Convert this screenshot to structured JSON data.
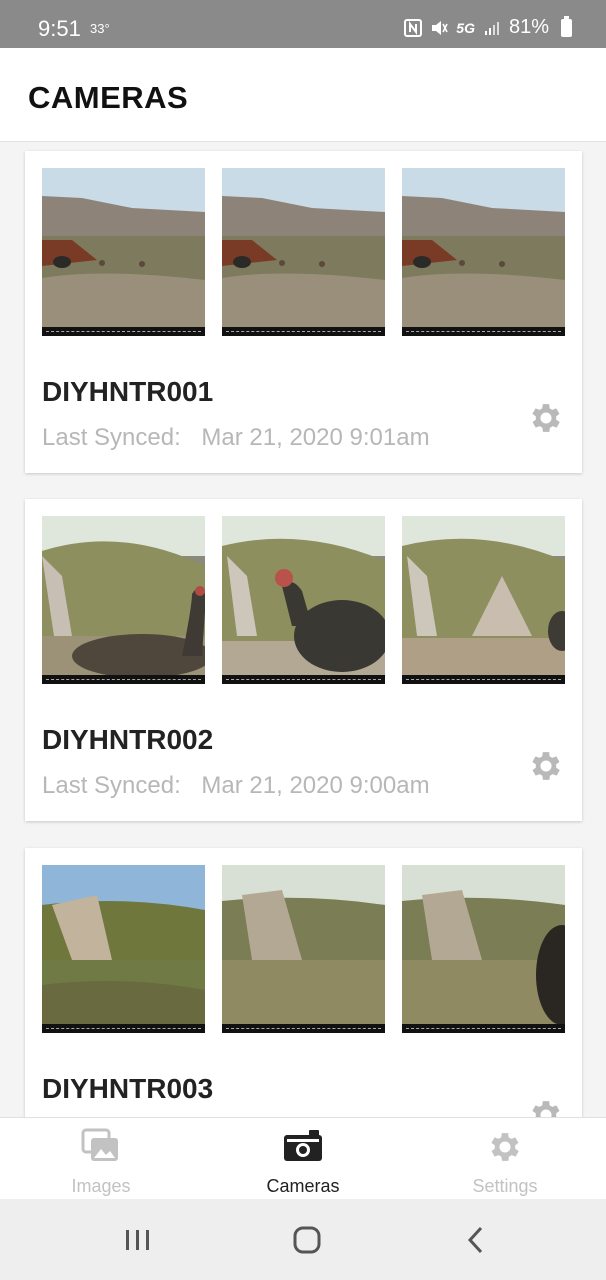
{
  "status_bar": {
    "time": "9:51",
    "temperature": "33°",
    "network": "5G",
    "battery": "81%"
  },
  "header": {
    "title": "CAMERAS"
  },
  "cameras": [
    {
      "name": "DIYHNTR001",
      "synced_label": "Last Synced:",
      "synced_value": "Mar 21, 2020 9:01am"
    },
    {
      "name": "DIYHNTR002",
      "synced_label": "Last Synced:",
      "synced_value": "Mar 21, 2020 9:00am"
    },
    {
      "name": "DIYHNTR003",
      "synced_label": "",
      "synced_value": ""
    }
  ],
  "tabs": [
    {
      "label": "Images",
      "icon": "images-icon"
    },
    {
      "label": "Cameras",
      "icon": "camera-icon"
    },
    {
      "label": "Settings",
      "icon": "gear-icon"
    }
  ],
  "colors": {
    "accent": "#222222",
    "inactive": "#c2c2c2",
    "status_bar": "#8a8a8a"
  }
}
